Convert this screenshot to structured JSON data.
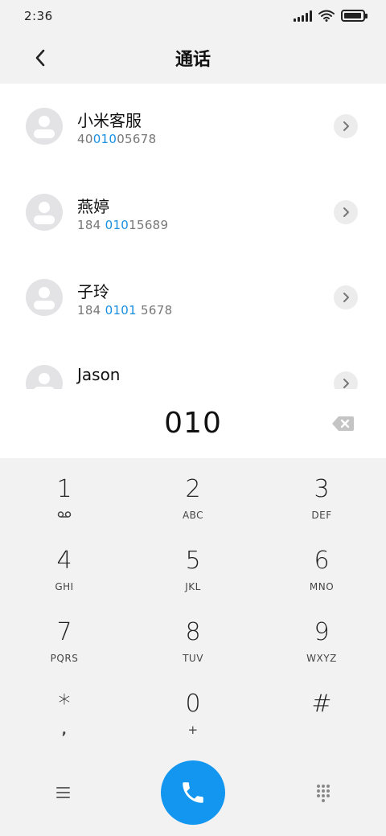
{
  "status_bar": {
    "time": "2:36",
    "battery_level": 0.95
  },
  "header": {
    "title": "通话",
    "back_icon": "chevron-left-icon"
  },
  "contacts": [
    {
      "name": "小米客服",
      "number_parts": [
        "40",
        "010",
        "05678"
      ]
    },
    {
      "name": "燕婷",
      "number_parts": [
        "184 ",
        "010",
        "15689"
      ]
    },
    {
      "name": "子玲",
      "number_parts": [
        "184 ",
        "0101",
        " 5678"
      ]
    },
    {
      "name": "Jason",
      "number_parts": [
        "",
        "",
        ""
      ]
    }
  ],
  "dialed_number": "010",
  "keypad": [
    {
      "digit": "1",
      "letters": "",
      "icon": "voicemail-icon"
    },
    {
      "digit": "2",
      "letters": "ABC"
    },
    {
      "digit": "3",
      "letters": "DEF"
    },
    {
      "digit": "4",
      "letters": "GHI"
    },
    {
      "digit": "5",
      "letters": "JKL"
    },
    {
      "digit": "6",
      "letters": "MNO"
    },
    {
      "digit": "7",
      "letters": "PQRS"
    },
    {
      "digit": "8",
      "letters": "TUV"
    },
    {
      "digit": "9",
      "letters": "WXYZ"
    },
    {
      "digit": "*",
      "letters": ","
    },
    {
      "digit": "0",
      "letters": "+"
    },
    {
      "digit": "#",
      "letters": ""
    }
  ],
  "colors": {
    "accent": "#1296f0",
    "highlight": "#1a8fe0",
    "background": "#f2f2f2"
  }
}
